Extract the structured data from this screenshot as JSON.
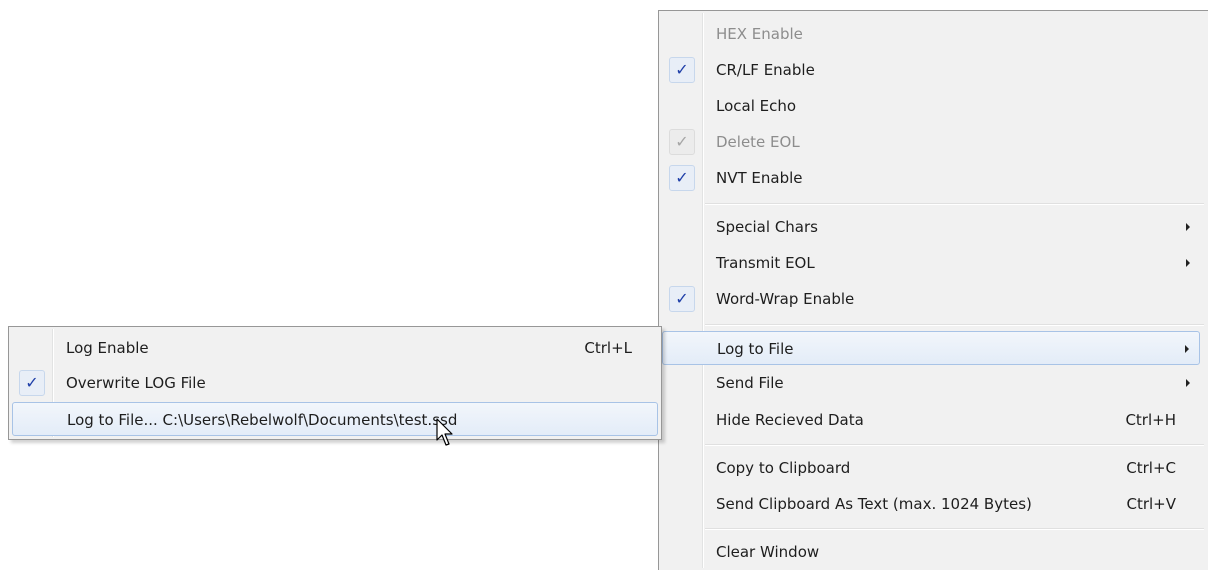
{
  "main_menu": {
    "hex_enable": {
      "label": "HEX Enable",
      "checked": false,
      "enabled": false
    },
    "crlf_enable": {
      "label": "CR/LF Enable",
      "checked": true,
      "enabled": true
    },
    "local_echo": {
      "label": "Local Echo",
      "checked": false,
      "enabled": true
    },
    "delete_eol": {
      "label": "Delete EOL",
      "checked": true,
      "enabled": false
    },
    "nvt_enable": {
      "label": "NVT Enable",
      "checked": true,
      "enabled": true
    },
    "special_chars": {
      "label": "Special Chars",
      "has_submenu": true
    },
    "transmit_eol": {
      "label": "Transmit EOL",
      "has_submenu": true
    },
    "word_wrap": {
      "label": "Word-Wrap Enable",
      "checked": true,
      "enabled": true
    },
    "log_to_file": {
      "label": "Log to File",
      "has_submenu": true,
      "highlighted": true
    },
    "send_file": {
      "label": "Send File",
      "has_submenu": true
    },
    "hide_received": {
      "label": "Hide Recieved Data",
      "shortcut": "Ctrl+H"
    },
    "copy_clipboard": {
      "label": "Copy to Clipboard",
      "shortcut": "Ctrl+C"
    },
    "send_clipboard": {
      "label": "Send Clipboard As Text (max. 1024 Bytes)",
      "shortcut": "Ctrl+V"
    },
    "clear_window": {
      "label": "Clear Window"
    }
  },
  "log_submenu": {
    "log_enable": {
      "label": "Log Enable",
      "shortcut": "Ctrl+L",
      "checked": false
    },
    "overwrite_log": {
      "label": "Overwrite LOG File",
      "checked": true
    },
    "log_to_file_path": {
      "label": "Log to File... C:\\Users\\Rebelwolf\\Documents\\test.ssd",
      "highlighted": true
    }
  },
  "icons": {
    "check": "checkmark-icon",
    "submenu": "triangle-right-icon",
    "cursor": "mouse-pointer-icon"
  },
  "colors": {
    "menu_background": "#f1f1f1",
    "menu_border": "#979797",
    "highlight_border": "#a8c3e6",
    "checkmark": "#1f3fa8",
    "disabled_text": "#8d8d8d"
  }
}
